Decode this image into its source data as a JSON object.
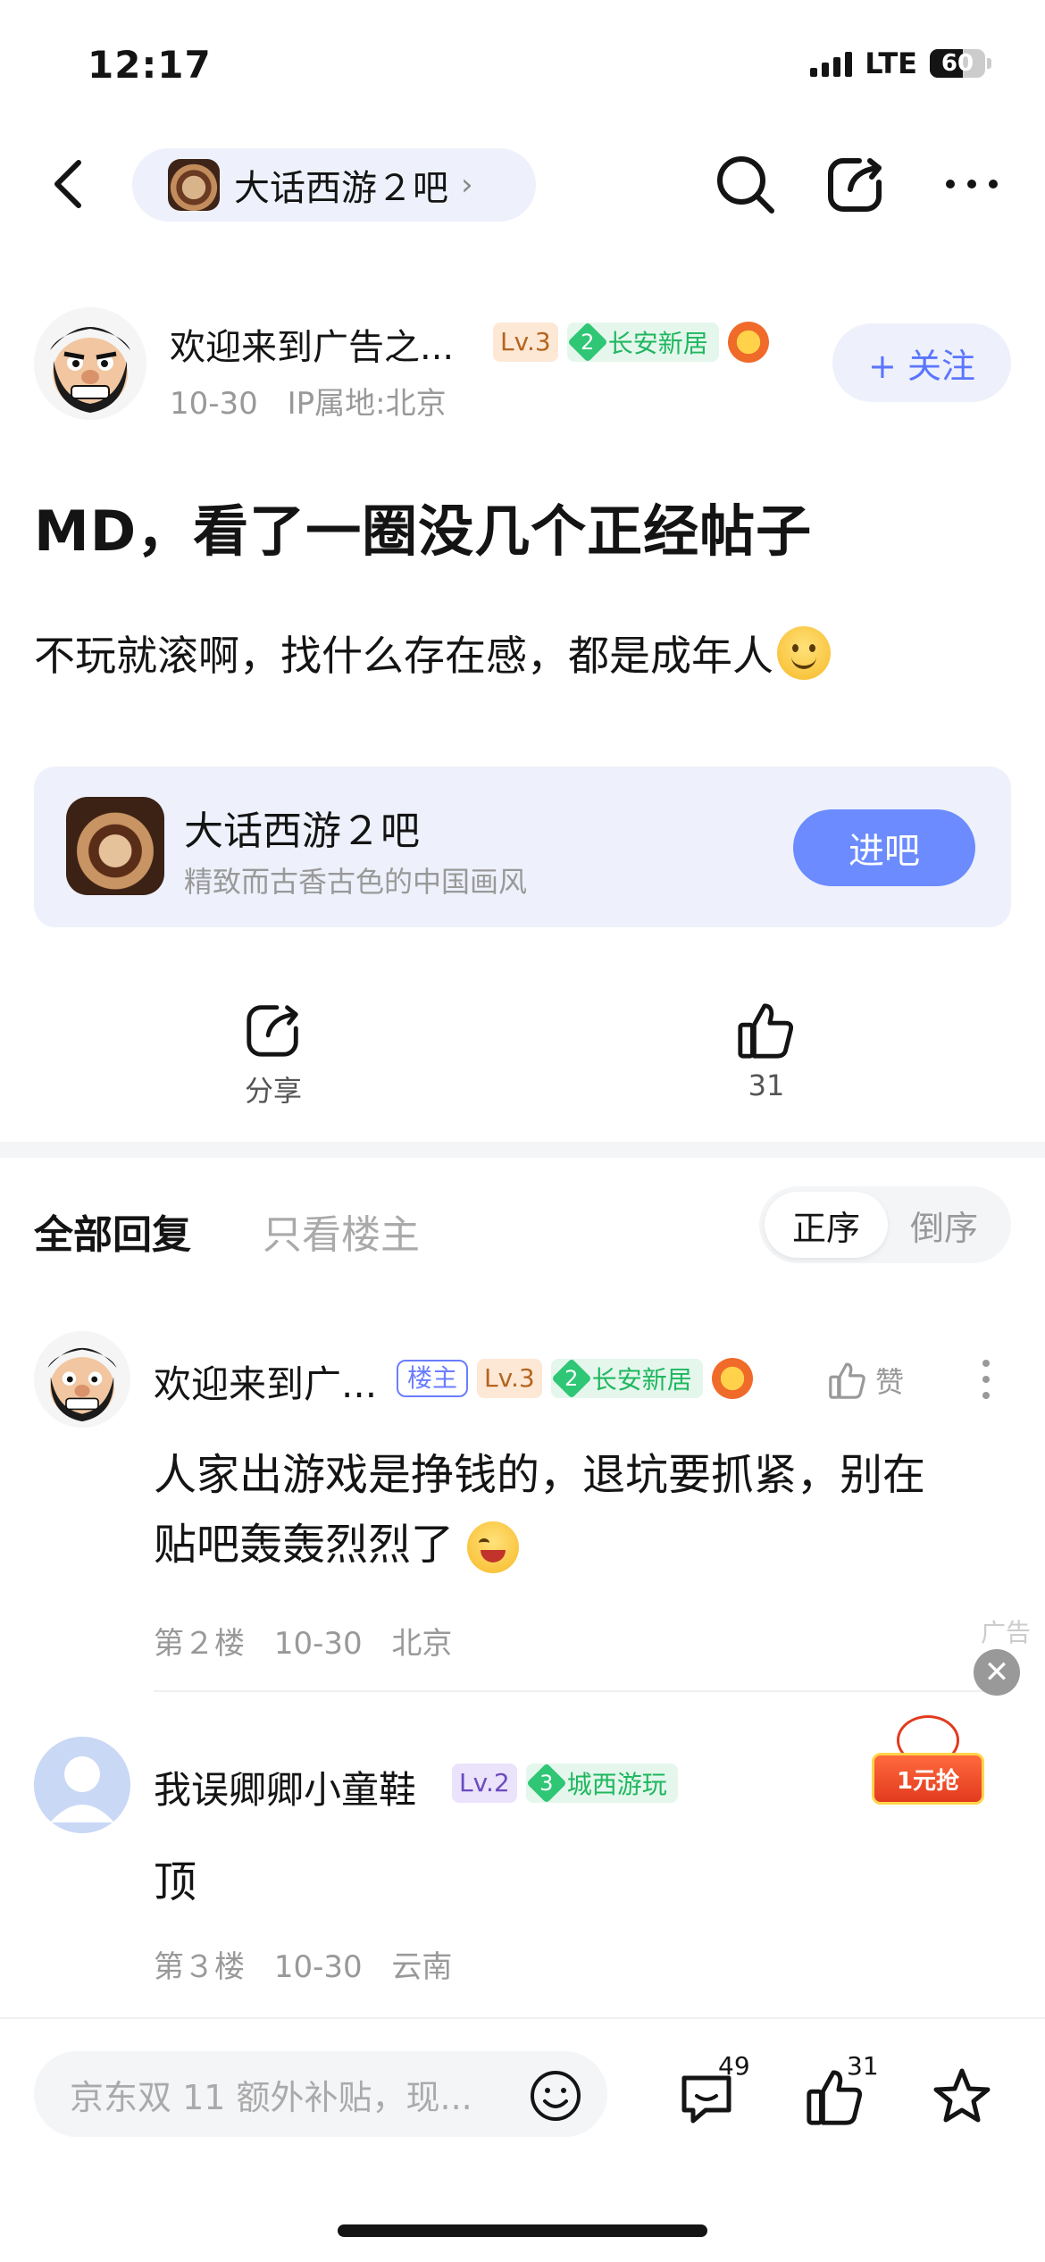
{
  "status_bar": {
    "time": "12:17",
    "network": "LTE",
    "battery": "60"
  },
  "nav": {
    "forum_name": "大话西游２吧",
    "chevron": "›"
  },
  "post": {
    "author": "欢迎来到广告之...",
    "level": "Lv.3",
    "badge_num": "2",
    "badge_title": "长安新居",
    "date": "10-30",
    "ip": "IP属地:北京",
    "follow_label": "+ 关注",
    "title": "MD，看了一圈没几个正经帖子",
    "body": "不玩就滚啊，找什么存在感，都是成年人"
  },
  "forum_card": {
    "name": "大话西游２吧",
    "desc": "精致而古香古色的中国画风",
    "enter_label": "进吧"
  },
  "actions": {
    "share_label": "分享",
    "like_count": "31"
  },
  "reply_tabs": {
    "all": "全部回复",
    "op_only": "只看楼主",
    "sort_asc": "正序",
    "sort_desc": "倒序"
  },
  "replies": [
    {
      "author": "欢迎来到广...",
      "op_tag": "楼主",
      "level": "Lv.3",
      "badge_num": "2",
      "badge_title": "长安新居",
      "like_label": "赞",
      "content_line1": "人家出游戏是挣钱的，退坑要抓紧，别在",
      "content_line2": "贴吧轰轰烈烈了",
      "floor": "第２楼",
      "date": "10-30",
      "location": "北京"
    },
    {
      "author": "我误卿卿小童鞋",
      "level": "Lv.2",
      "badge_num": "3",
      "badge_title": "城西游玩",
      "content": "顶",
      "floor": "第３楼",
      "date": "10-30",
      "location": "云南"
    }
  ],
  "ad": {
    "label": "广告",
    "close": "✕",
    "promo": "1元抢"
  },
  "bottom_bar": {
    "input_placeholder": "京东双 11 额外补贴，现...",
    "comment_count": "49",
    "like_count": "31"
  },
  "colors": {
    "accent": "#6b8bff",
    "follow_text": "#5a76ff",
    "badge_green": "#20b760"
  }
}
